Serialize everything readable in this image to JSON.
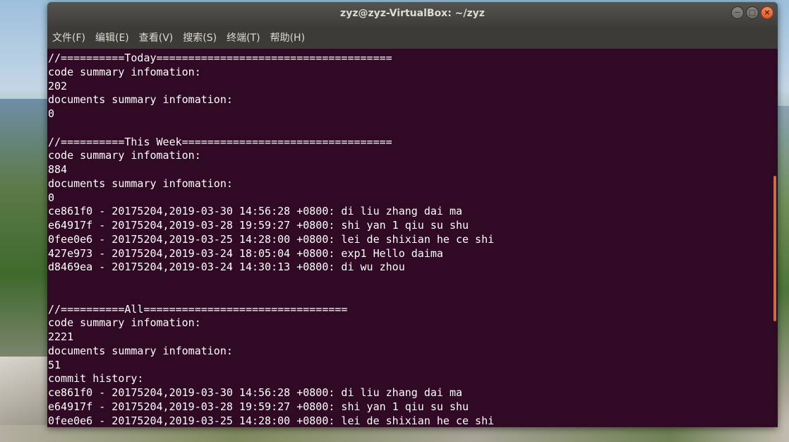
{
  "window": {
    "title": "zyz@zyz-VirtualBox: ~/zyz",
    "controls": {
      "minimize": "−",
      "maximize": "□",
      "close": "×"
    }
  },
  "menu": [
    "文件(F)",
    "编辑(E)",
    "查看(V)",
    "搜索(S)",
    "终端(T)",
    "帮助(H)"
  ],
  "terminal": {
    "lines": [
      "//==========Today=====================================",
      "code summary infomation:",
      "202",
      "documents summary infomation:",
      "0",
      "",
      "//==========This Week=================================",
      "code summary infomation:",
      "884",
      "documents summary infomation:",
      "0",
      "ce861f0 - 20175204,2019-03-30 14:56:28 +0800: di liu zhang dai ma",
      "e64917f - 20175204,2019-03-28 19:59:27 +0800: shi yan 1 qiu su shu",
      "0fee0e6 - 20175204,2019-03-25 14:28:00 +0800: lei de shixian he ce shi",
      "427e973 - 20175204,2019-03-24 18:05:04 +0800: exp1 Hello daima",
      "d8469ea - 20175204,2019-03-24 14:30:13 +0800: di wu zhou",
      "",
      "",
      "//==========All================================",
      "code summary infomation:",
      "2221",
      "documents summary infomation:",
      "51",
      "commit history:",
      "ce861f0 - 20175204,2019-03-30 14:56:28 +0800: di liu zhang dai ma",
      "e64917f - 20175204,2019-03-28 19:59:27 +0800: shi yan 1 qiu su shu",
      "0fee0e6 - 20175204,2019-03-25 14:28:00 +0800: lei de shixian he ce shi"
    ]
  },
  "colors": {
    "terminal_bg": "#300a24",
    "terminal_fg": "#ffffff",
    "titlebar": "#3c3b37",
    "close_button": "#e95420"
  }
}
